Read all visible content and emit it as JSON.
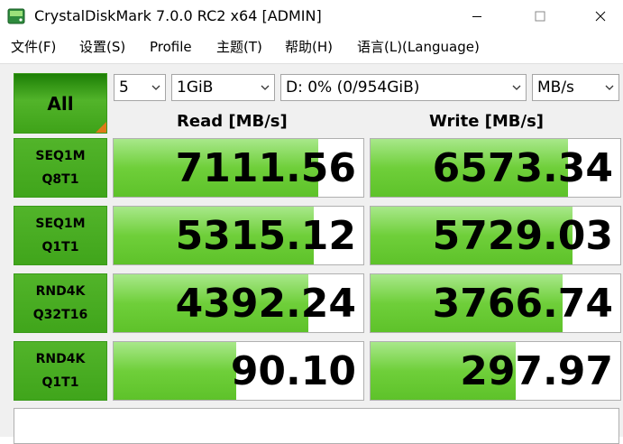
{
  "window": {
    "title": "CrystalDiskMark 7.0.0 RC2 x64 [ADMIN]",
    "icon": "app-disk-icon",
    "controls": [
      "minimize-icon",
      "maximize-icon",
      "close-icon"
    ]
  },
  "menu": [
    {
      "label": "文件(F)"
    },
    {
      "label": "设置(S)"
    },
    {
      "label": "Profile"
    },
    {
      "label": "主题(T)"
    },
    {
      "label": "帮助(H)"
    },
    {
      "label": "语言(L)(Language)"
    }
  ],
  "toolbar": {
    "all_label": "All",
    "count": "5",
    "size": "1GiB",
    "drive": "D: 0% (0/954GiB)",
    "unit": "MB/s"
  },
  "headers": {
    "read": "Read [MB/s]",
    "write": "Write [MB/s]"
  },
  "tests": [
    {
      "line1": "SEQ1M",
      "line2": "Q8T1",
      "read": "7111.56",
      "write": "6573.34",
      "read_fill": 0.82,
      "write_fill": 0.79
    },
    {
      "line1": "SEQ1M",
      "line2": "Q1T1",
      "read": "5315.12",
      "write": "5729.03",
      "read_fill": 0.8,
      "write_fill": 0.81
    },
    {
      "line1": "RND4K",
      "line2": "Q32T16",
      "read": "4392.24",
      "write": "3766.74",
      "read_fill": 0.78,
      "write_fill": 0.77
    },
    {
      "line1": "RND4K",
      "line2": "Q1T1",
      "read": "90.10",
      "write": "297.97",
      "read_fill": 0.49,
      "write_fill": 0.58
    }
  ],
  "colors": {
    "accent_green": "#52b42a",
    "fill_green": "#6fcf3a",
    "corner_orange": "#e07a18"
  }
}
